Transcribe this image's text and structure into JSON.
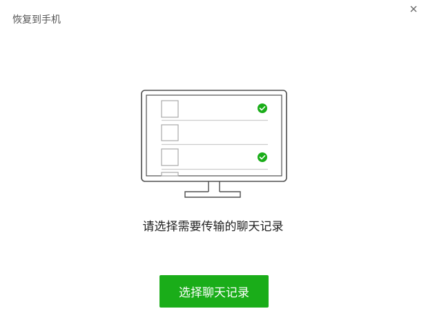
{
  "window": {
    "title": "恢复到手机",
    "close_icon": "close-icon"
  },
  "illustration": {
    "icon": "monitor-chat-list-icon",
    "check_color": "#1aad19"
  },
  "main": {
    "instruction": "请选择需要传输的聊天记录",
    "select_button_label": "选择聊天记录",
    "accent_color": "#1aad19"
  }
}
